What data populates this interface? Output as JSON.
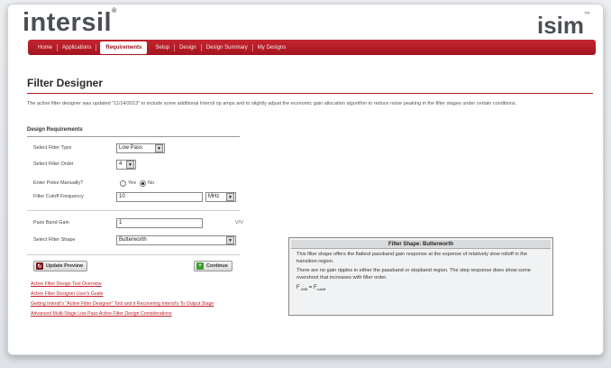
{
  "header": {
    "logo_text": "intersil",
    "logo_reg": "®",
    "brand": "isim",
    "brand_tm": "™"
  },
  "nav": {
    "items": [
      {
        "label": "Home",
        "active": false
      },
      {
        "label": "Applications",
        "active": false
      },
      {
        "label": "Requirements",
        "active": true
      },
      {
        "label": "Setup",
        "active": false
      },
      {
        "label": "Design",
        "active": false
      },
      {
        "label": "Design Summary",
        "active": false
      },
      {
        "label": "My Designs",
        "active": false
      }
    ]
  },
  "page": {
    "title": "Filter Designer",
    "intro": "The active filter designer was updated \"11/14/2013\" to include some additional Intersil op amps and to slightly adjust the economic gain allocation algorithm to reduce noise peaking in the filter stages under certain conditions."
  },
  "form": {
    "section_heading": "Design Requirements",
    "filter_type": {
      "label": "Select Filter Type",
      "value": "Low Pass"
    },
    "filter_order": {
      "label": "Select Filter Order",
      "value": "4"
    },
    "enter_poles": {
      "label": "Enter Poles Manually?",
      "yes": "Yes",
      "no": "No",
      "selected": "No"
    },
    "cutoff": {
      "label": "Filter Cutoff Frequency",
      "value": "10",
      "unit": "MHz"
    },
    "passband_gain": {
      "label": "Pass Band Gain",
      "value": "1",
      "unit": "V/V"
    },
    "filter_shape": {
      "label": "Select Filter Shape",
      "value": "Butterworth"
    }
  },
  "buttons": {
    "update_preview": "Update Preview",
    "continue": "Continue"
  },
  "links": [
    "Active Filter Design Tool Overview",
    "Active Filter Designer User's Guide",
    "Getting Intersil's \"Active Filter Designer\" Tool and it Recovering Intersil's To Output Stage",
    "Advanced Multi-Stage Low Pass Active Filter Design Considerations"
  ],
  "shape_info": {
    "title": "Filter Shape: Butterworth",
    "text_1": "This filter shape offers the flattest passband gain response at the expense of relatively slow rolloff in the transition region.",
    "text_2": "There are no gain ripples in either the passband or stopband region. The step response does show some overshoot that increases with filter order.",
    "formula_left": "F",
    "formula_left_sub": "-3dB",
    "formula_eq": " = F",
    "formula_right_sub": "cutoff"
  }
}
